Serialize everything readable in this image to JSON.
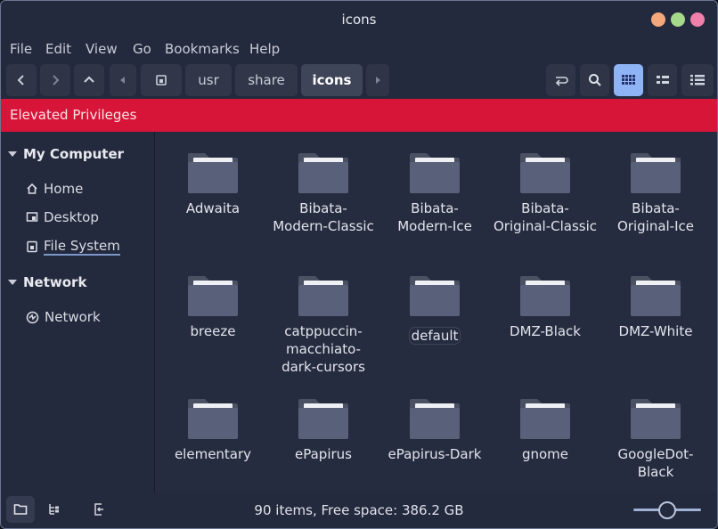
{
  "window": {
    "title": "icons",
    "controls": [
      {
        "name": "minimize-button",
        "color": "#f4a77a"
      },
      {
        "name": "maximize-button",
        "color": "#a6d98b"
      },
      {
        "name": "close-button",
        "color": "#f07faa"
      }
    ]
  },
  "menubar": [
    "File",
    "Edit",
    "View",
    "Go",
    "Bookmarks",
    "Help"
  ],
  "breadcrumb": [
    "usr",
    "share",
    "icons"
  ],
  "banner": {
    "text": "Elevated Privileges",
    "color": "#d71538"
  },
  "sidebar": {
    "sections": [
      {
        "title": "My Computer",
        "items": [
          {
            "label": "Home",
            "icon": "home-icon"
          },
          {
            "label": "Desktop",
            "icon": "desktop-icon"
          },
          {
            "label": "File System",
            "icon": "drive-icon"
          }
        ]
      },
      {
        "title": "Network",
        "items": [
          {
            "label": "Network",
            "icon": "network-icon"
          }
        ]
      }
    ]
  },
  "files": [
    [
      "Adwaita"
    ],
    [
      "Bibata-",
      "Modern-Classic"
    ],
    [
      "Bibata-",
      "Modern-Ice"
    ],
    [
      "Bibata-",
      "Original-Classic"
    ],
    [
      "Bibata-",
      "Original-Ice"
    ],
    [
      "breeze"
    ],
    [
      "catppuccin-",
      "macchiato-",
      "dark-cursors"
    ],
    [
      "default"
    ],
    [
      "DMZ-Black"
    ],
    [
      "DMZ-White"
    ],
    [
      "elementary"
    ],
    [
      "ePapirus"
    ],
    [
      "ePapirus-Dark"
    ],
    [
      "gnome"
    ],
    [
      "GoogleDot-",
      "Black"
    ]
  ],
  "status": {
    "text": "90 items, Free space: 386.2 GB"
  },
  "accent": "#8fb4f5"
}
